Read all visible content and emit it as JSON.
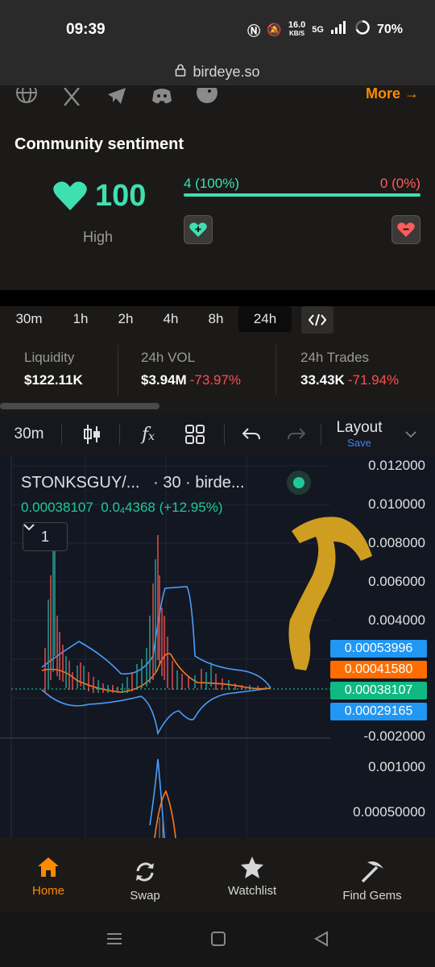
{
  "status_bar": {
    "time": "09:39",
    "net_speed": "16.0",
    "net_unit": "KB/S",
    "network": "5G",
    "battery": "70%"
  },
  "browser": {
    "url": "birdeye.so"
  },
  "header": {
    "more_label": "More →"
  },
  "sentiment": {
    "title": "Community sentiment",
    "score": "100",
    "score_label": "High",
    "positive": "4 (100%)",
    "negative": "0 (0%)",
    "positive_fraction": 1.0,
    "colors": {
      "positive": "#3fe0b0",
      "negative": "#ff5c5c"
    }
  },
  "timeframes": {
    "items": [
      "30m",
      "1h",
      "2h",
      "4h",
      "8h",
      "24h"
    ],
    "active": "24h"
  },
  "stats": {
    "liquidity_label": "Liquidity",
    "liquidity_value": "$122.11K",
    "vol_label": "24h VOL",
    "vol_value": "$3.94M",
    "vol_change": "-73.97%",
    "trades_label": "24h Trades",
    "trades_value": "33.43K",
    "trades_change": "-71.94%"
  },
  "chart_toolbar": {
    "interval": "30m",
    "layout_label": "Layout",
    "layout_sub": "Save"
  },
  "chart": {
    "pair_title": "STONKSGUY/...",
    "pair_meta": "· 30 · birde...",
    "last_price": "0.00038107",
    "change_prefix": "0.0",
    "change_sub": "4",
    "change_rest": "4368 (+12.95%)",
    "indicator_count": "1",
    "y_axis_labels": [
      "0.012000",
      "0.010000",
      "0.008000",
      "0.006000",
      "0.004000",
      "-0.002000"
    ],
    "volume_axis_labels": [
      "0.001000",
      "0.00050000"
    ],
    "price_tags": [
      {
        "value": "0.00053996",
        "color": "#2196f3"
      },
      {
        "value": "0.00041580",
        "color": "#ff6d00"
      },
      {
        "value": "0.00038107",
        "color": "#10b981"
      },
      {
        "value": "0.00029165",
        "color": "#2196f3"
      }
    ]
  },
  "bottom_nav": {
    "home": "Home",
    "swap": "Swap",
    "watchlist": "Watchlist",
    "find_gems": "Find Gems",
    "active": "Home",
    "accent": "#ff8a00"
  }
}
